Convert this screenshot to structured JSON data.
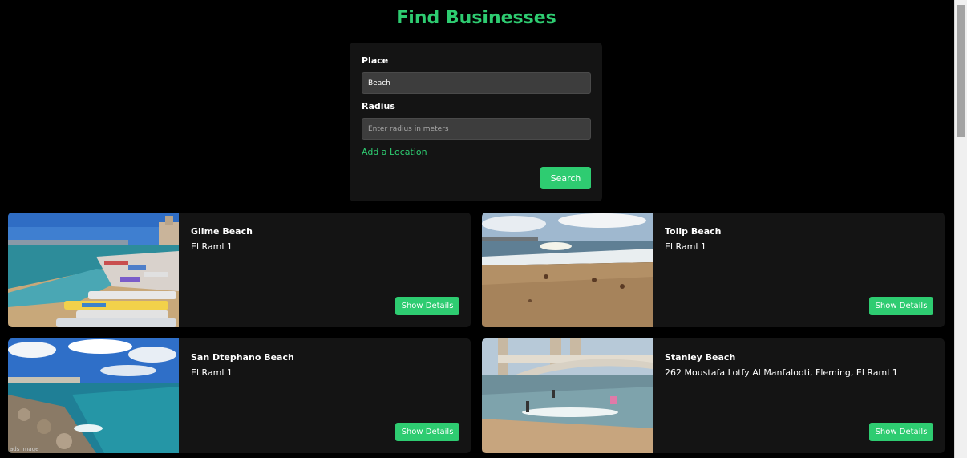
{
  "page": {
    "title": "Find Businesses"
  },
  "search_form": {
    "place_label": "Place",
    "place_value": "Beach",
    "radius_label": "Radius",
    "radius_value": "",
    "radius_placeholder": "Enter radius in meters",
    "add_location_label": "Add a Location",
    "search_label": "Search"
  },
  "results": [
    {
      "name": "Glime Beach",
      "address": "El Raml 1",
      "button_label": "Show Details",
      "image_icon": "crowded-beach-photo"
    },
    {
      "name": "Tolip Beach",
      "address": "El Raml 1",
      "button_label": "Show Details",
      "image_icon": "sandy-shore-photo"
    },
    {
      "name": "San Dtephano Beach",
      "address": "El Raml 1",
      "button_label": "Show Details",
      "image_icon": "rocky-coast-photo",
      "image_watermark": "ads image"
    },
    {
      "name": "Stanley Beach",
      "address": "262 Moustafa Lotfy Al Manfalooti, Fleming, El Raml 1",
      "button_label": "Show Details",
      "image_icon": "bridge-beach-photo"
    }
  ],
  "colors": {
    "accent": "#2ecc71",
    "background": "#000000",
    "panel": "#141414",
    "input": "#3d3d3d"
  }
}
